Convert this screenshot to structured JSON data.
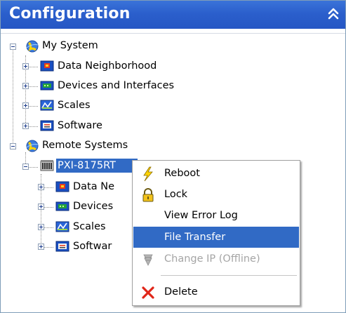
{
  "panel": {
    "title": "Configuration",
    "collapse_icon": "double-chevron-up-icon"
  },
  "tree": {
    "my_system": {
      "label": "My System",
      "expanded": true,
      "children": [
        "Data Neighborhood",
        "Devices and Interfaces",
        "Scales",
        "Software"
      ]
    },
    "remote_systems": {
      "label": "Remote Systems",
      "expanded": true,
      "target": {
        "label": "PXI-8175RT",
        "visible_label": "PXI-8175RT",
        "selected": true,
        "children_visible": [
          "Data Ne",
          "Devices",
          "Scales",
          "Softwar"
        ]
      }
    }
  },
  "context_menu": {
    "items": [
      {
        "label": "Reboot",
        "icon": "lightning-bolt-icon",
        "state": "normal"
      },
      {
        "label": "Lock",
        "icon": "padlock-icon",
        "state": "normal"
      },
      {
        "label": "View Error Log",
        "icon": "",
        "state": "normal"
      },
      {
        "label": "File Transfer",
        "icon": "",
        "state": "highlighted"
      },
      {
        "label": "Change IP (Offline)",
        "icon": "network-settings-icon",
        "state": "disabled"
      },
      {
        "label": "Delete",
        "icon": "red-x-delete-icon",
        "state": "normal"
      }
    ]
  },
  "colors": {
    "titlebar": "#2b5fcc",
    "selection": "#316ac5",
    "disabled_text": "#a5a5a5"
  }
}
